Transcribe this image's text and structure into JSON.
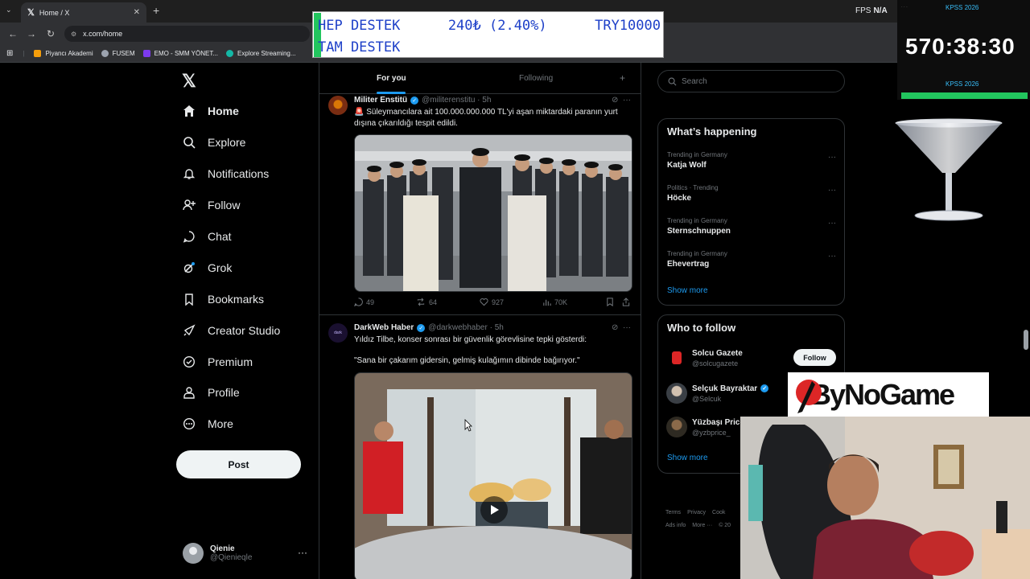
{
  "browser": {
    "tab_title": "Home / X",
    "tab_logo": "𝕏",
    "tab_close": "✕",
    "new_tab": "+",
    "tab_menu": "⌄",
    "url": "x.com/home",
    "fps_label": "FPS",
    "fps_value": "N/A",
    "bookmarks": [
      {
        "label": "Piyancı Akademi",
        "color": "#f59e0b"
      },
      {
        "label": "FUSEM",
        "color": "#9ca3af"
      },
      {
        "label": "EMO - SMM YÖNET...",
        "color": "#7c3aed"
      },
      {
        "label": "Explore Streaming...",
        "color": "#14b8a6"
      }
    ]
  },
  "banner": {
    "line1_left": "HEP DESTEK",
    "line1_mid": "240₺ (2.40%)",
    "line1_right": "TRY10000",
    "line2": "TAM DESTEK"
  },
  "timer": {
    "top_label": "KPSS 2026",
    "time": "570:38:30",
    "bottom_label": "KPSS 2026",
    "progress": 1.0
  },
  "nav": {
    "logo": "𝕏",
    "items": [
      {
        "label": "Home",
        "icon": "home-icon"
      },
      {
        "label": "Explore",
        "icon": "search-icon"
      },
      {
        "label": "Notifications",
        "icon": "bell-icon"
      },
      {
        "label": "Follow",
        "icon": "person-plus-icon"
      },
      {
        "label": "Chat",
        "icon": "chat-icon"
      },
      {
        "label": "Grok",
        "icon": "grok-icon"
      },
      {
        "label": "Bookmarks",
        "icon": "bookmark-icon"
      },
      {
        "label": "Creator Studio",
        "icon": "rocket-icon"
      },
      {
        "label": "Premium",
        "icon": "verified-badge-icon"
      },
      {
        "label": "Profile",
        "icon": "profile-icon"
      },
      {
        "label": "More",
        "icon": "more-circle-icon"
      }
    ],
    "post_label": "Post",
    "account_name": "Qienie",
    "account_handle": "@Qienieqle",
    "account_more": "···"
  },
  "feed": {
    "tab_for_you": "For you",
    "tab_following": "Following",
    "tab_add": "+",
    "tweets": [
      {
        "name": "Militer Enstitü",
        "handle": "@militerenstitu · 5h",
        "text": "🚨 Süleymancılara ait 100.000.000.000 TL'yi aşan miktardaki paranın yurt dışına çıkarıldığı tespit edildi.",
        "replies": "49",
        "reposts": "64",
        "likes": "927",
        "views": "70K"
      },
      {
        "name": "DarkWeb Haber",
        "handle": "@darkwebhaber · 5h",
        "text": "Yıldız Tilbe, konser sonrası bir güvenlik görevlisine tepki gösterdi:",
        "quote": "\"Sana bir çakarım gidersin, gelmiş kulağımın dibinde bağırıyor.\""
      }
    ]
  },
  "right": {
    "search_placeholder": "Search",
    "happening_title": "What’s happening",
    "trends": [
      {
        "meta": "Trending in Germany",
        "title": "Katja Wolf"
      },
      {
        "meta": "Politics · Trending",
        "title": "Höcke"
      },
      {
        "meta": "Trending in Germany",
        "title": "Sternschnuppen"
      },
      {
        "meta": "Trending in Germany",
        "title": "Ehevertrag"
      }
    ],
    "show_more": "Show more",
    "who_title": "Who to follow",
    "who": [
      {
        "name": "Solcu Gazete",
        "handle": "@solcugazete"
      },
      {
        "name": "Selçuk Bayraktar",
        "handle": "@Selcuk"
      },
      {
        "name": "Yüzbaşı Price",
        "handle": "@yzbprice_"
      }
    ],
    "follow_label": "Follow",
    "who_show_more": "Show more",
    "footer": [
      "Terms",
      "Privacy",
      "Cook",
      "Ads info",
      "More ···",
      "© 20"
    ]
  },
  "overlays": {
    "bynogame": "ByNoGame"
  }
}
